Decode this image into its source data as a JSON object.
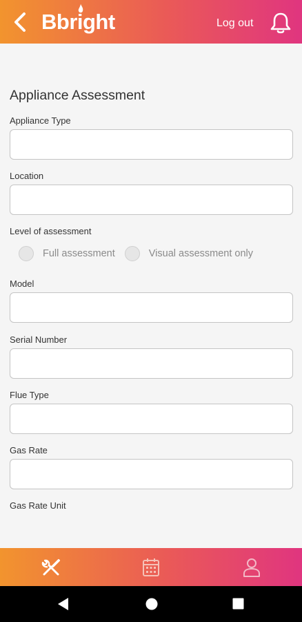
{
  "header": {
    "logo_text": "Bbright",
    "logout_label": "Log out",
    "gradient_start": "#f2942e",
    "gradient_end": "#e0357f"
  },
  "form": {
    "title": "Appliance Assessment",
    "fields": {
      "appliance_type": {
        "label": "Appliance Type",
        "value": ""
      },
      "location": {
        "label": "Location",
        "value": ""
      },
      "model": {
        "label": "Model",
        "value": ""
      },
      "serial_number": {
        "label": "Serial Number",
        "value": ""
      },
      "flue_type": {
        "label": "Flue Type",
        "value": ""
      },
      "gas_rate": {
        "label": "Gas Rate",
        "value": ""
      },
      "gas_rate_unit": {
        "label": "Gas Rate Unit"
      }
    },
    "assessment_level": {
      "label": "Level of assessment",
      "options": [
        "Full assessment",
        "Visual assessment only"
      ],
      "selected": null
    }
  },
  "bottom_nav": {
    "items": [
      {
        "icon": "tools-icon",
        "active": true
      },
      {
        "icon": "calendar-icon",
        "active": false
      },
      {
        "icon": "profile-icon",
        "active": false
      }
    ]
  },
  "system_nav": {
    "items": [
      "back-triangle-icon",
      "home-circle-icon",
      "recents-square-icon"
    ]
  }
}
